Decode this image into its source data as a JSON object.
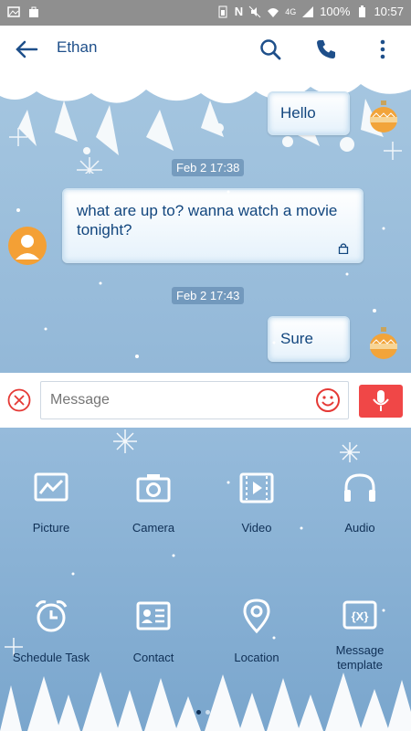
{
  "status_bar": {
    "battery": "100%",
    "time": "10:57",
    "network": "4G"
  },
  "header": {
    "contact_name": "Ethan"
  },
  "messages": [
    {
      "type": "sent",
      "text": "Hello"
    },
    {
      "type": "date",
      "text": "Feb 2 17:38"
    },
    {
      "type": "received",
      "text": "what are up to? wanna watch a movie tonight?"
    },
    {
      "type": "date",
      "text": "Feb 2 17:43"
    },
    {
      "type": "sent",
      "text": "Sure"
    }
  ],
  "composer": {
    "placeholder": "Message"
  },
  "attachments": [
    {
      "label": "Picture",
      "icon": "picture-icon"
    },
    {
      "label": "Camera",
      "icon": "camera-icon"
    },
    {
      "label": "Video",
      "icon": "video-icon"
    },
    {
      "label": "Audio",
      "icon": "headphones-icon"
    },
    {
      "label": "Schedule Task",
      "icon": "alarm-clock-icon"
    },
    {
      "label": "Contact",
      "icon": "contact-card-icon"
    },
    {
      "label": "Location",
      "icon": "location-pin-icon"
    },
    {
      "label": "Message template",
      "icon": "template-icon"
    }
  ],
  "colors": {
    "accent": "#1e4f8a",
    "mic": "#f04747",
    "avatar": "#f4a035"
  }
}
